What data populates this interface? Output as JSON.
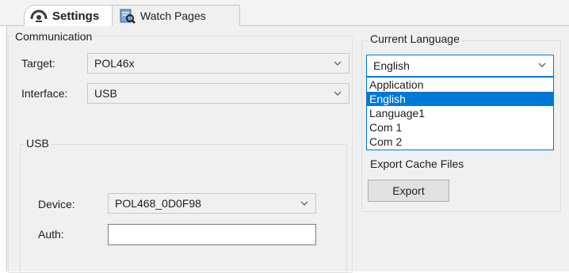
{
  "tabs": [
    {
      "label": "Settings",
      "icon": "settings-gear-icon",
      "active": true
    },
    {
      "label": "Watch Pages",
      "icon": "watch-pages-icon",
      "active": false
    }
  ],
  "communication": {
    "title": "Communication",
    "target_label": "Target:",
    "target_value": "POL46x",
    "interface_label": "Interface:",
    "interface_value": "USB"
  },
  "usb": {
    "title": "USB",
    "device_label": "Device:",
    "device_value": "POL468_0D0F98",
    "auth_label": "Auth:",
    "auth_value": ""
  },
  "language": {
    "title": "Current Language",
    "selected": "English",
    "options": [
      "Application",
      "English",
      "Language1",
      "Com 1",
      "Com 2"
    ],
    "highlighted_index": 1
  },
  "export": {
    "title": "Export Cache Files",
    "button_label": "Export"
  },
  "colors": {
    "accent": "#0078d7",
    "panel_bg": "#f0f0f0",
    "border": "#c8c8c8"
  }
}
